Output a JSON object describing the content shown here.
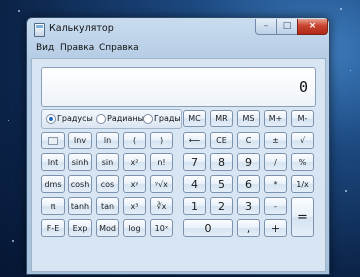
{
  "window": {
    "title": "Калькулятор"
  },
  "title_buttons": {
    "minimize": "–",
    "maximize": "□",
    "close": "×"
  },
  "menu": [
    "Вид",
    "Правка",
    "Справка"
  ],
  "display": {
    "value": "0"
  },
  "angle_mode": {
    "options": [
      "Градусы",
      "Радианы",
      "Грады"
    ],
    "selected": "Градусы"
  },
  "keys": {
    "row1": [
      "MC",
      "MR",
      "MS",
      "M+",
      "M-"
    ],
    "row2": [
      "Inv",
      "ln",
      "(",
      ")",
      "⟵",
      "CE",
      "C",
      "±",
      "√"
    ],
    "row3": [
      "Int",
      "sinh",
      "sin",
      "x²",
      "n!",
      "7",
      "8",
      "9",
      "/",
      "%"
    ],
    "row4": [
      "dms",
      "cosh",
      "cos",
      "xʸ",
      "ʸ√x",
      "4",
      "5",
      "6",
      "*",
      "1/x"
    ],
    "row5": [
      "π",
      "tanh",
      "tan",
      "x³",
      "∛x",
      "1",
      "2",
      "3",
      "-",
      "="
    ],
    "row6": [
      "F-E",
      "Exp",
      "Mod",
      "log",
      "10ˣ",
      "0",
      ",",
      "+"
    ]
  }
}
